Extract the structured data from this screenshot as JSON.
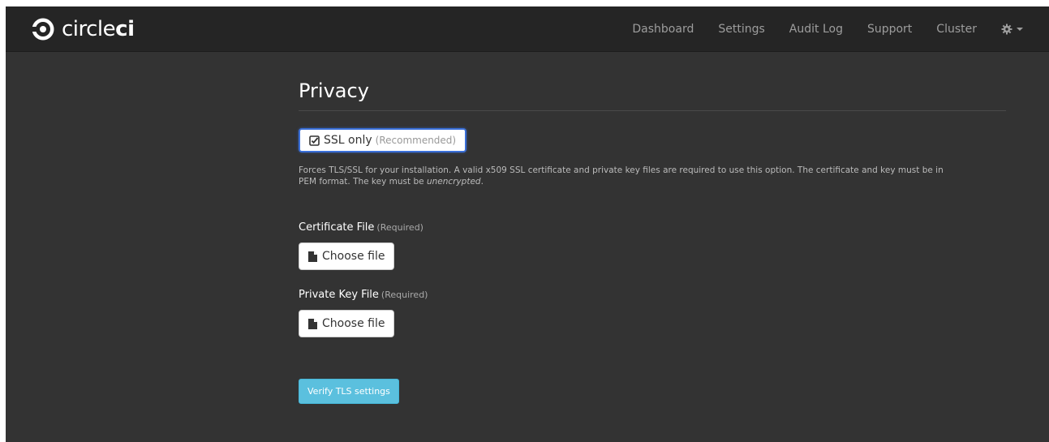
{
  "brand": {
    "name_light": "circle",
    "name_bold": "ci",
    "icon": "circleci-logo-icon"
  },
  "nav": {
    "items": [
      "Dashboard",
      "Settings",
      "Audit Log",
      "Support",
      "Cluster"
    ],
    "settings_icon": "gear-icon"
  },
  "page": {
    "title": "Privacy"
  },
  "ssl": {
    "icon": "checkbox-checked-icon",
    "label": "SSL only",
    "hint": "(Recommended)",
    "checked": true
  },
  "help": {
    "text_before": "Forces TLS/SSL for your installation. A valid x509 SSL certificate and private key files are required to use this option. The certificate and key must be in PEM format. The key must be ",
    "text_em": "unencrypted",
    "text_after": "."
  },
  "certificate": {
    "label": "Certificate File",
    "required": "(Required)",
    "button": "Choose file",
    "icon": "file-icon"
  },
  "private_key": {
    "label": "Private Key File",
    "required": "(Required)",
    "button": "Choose file",
    "icon": "file-icon"
  },
  "verify": {
    "label": "Verify TLS settings"
  },
  "colors": {
    "background": "#333333",
    "navbar": "#252525",
    "verify_button": "#5bc0de",
    "focus_border": "#3a6fd8"
  }
}
